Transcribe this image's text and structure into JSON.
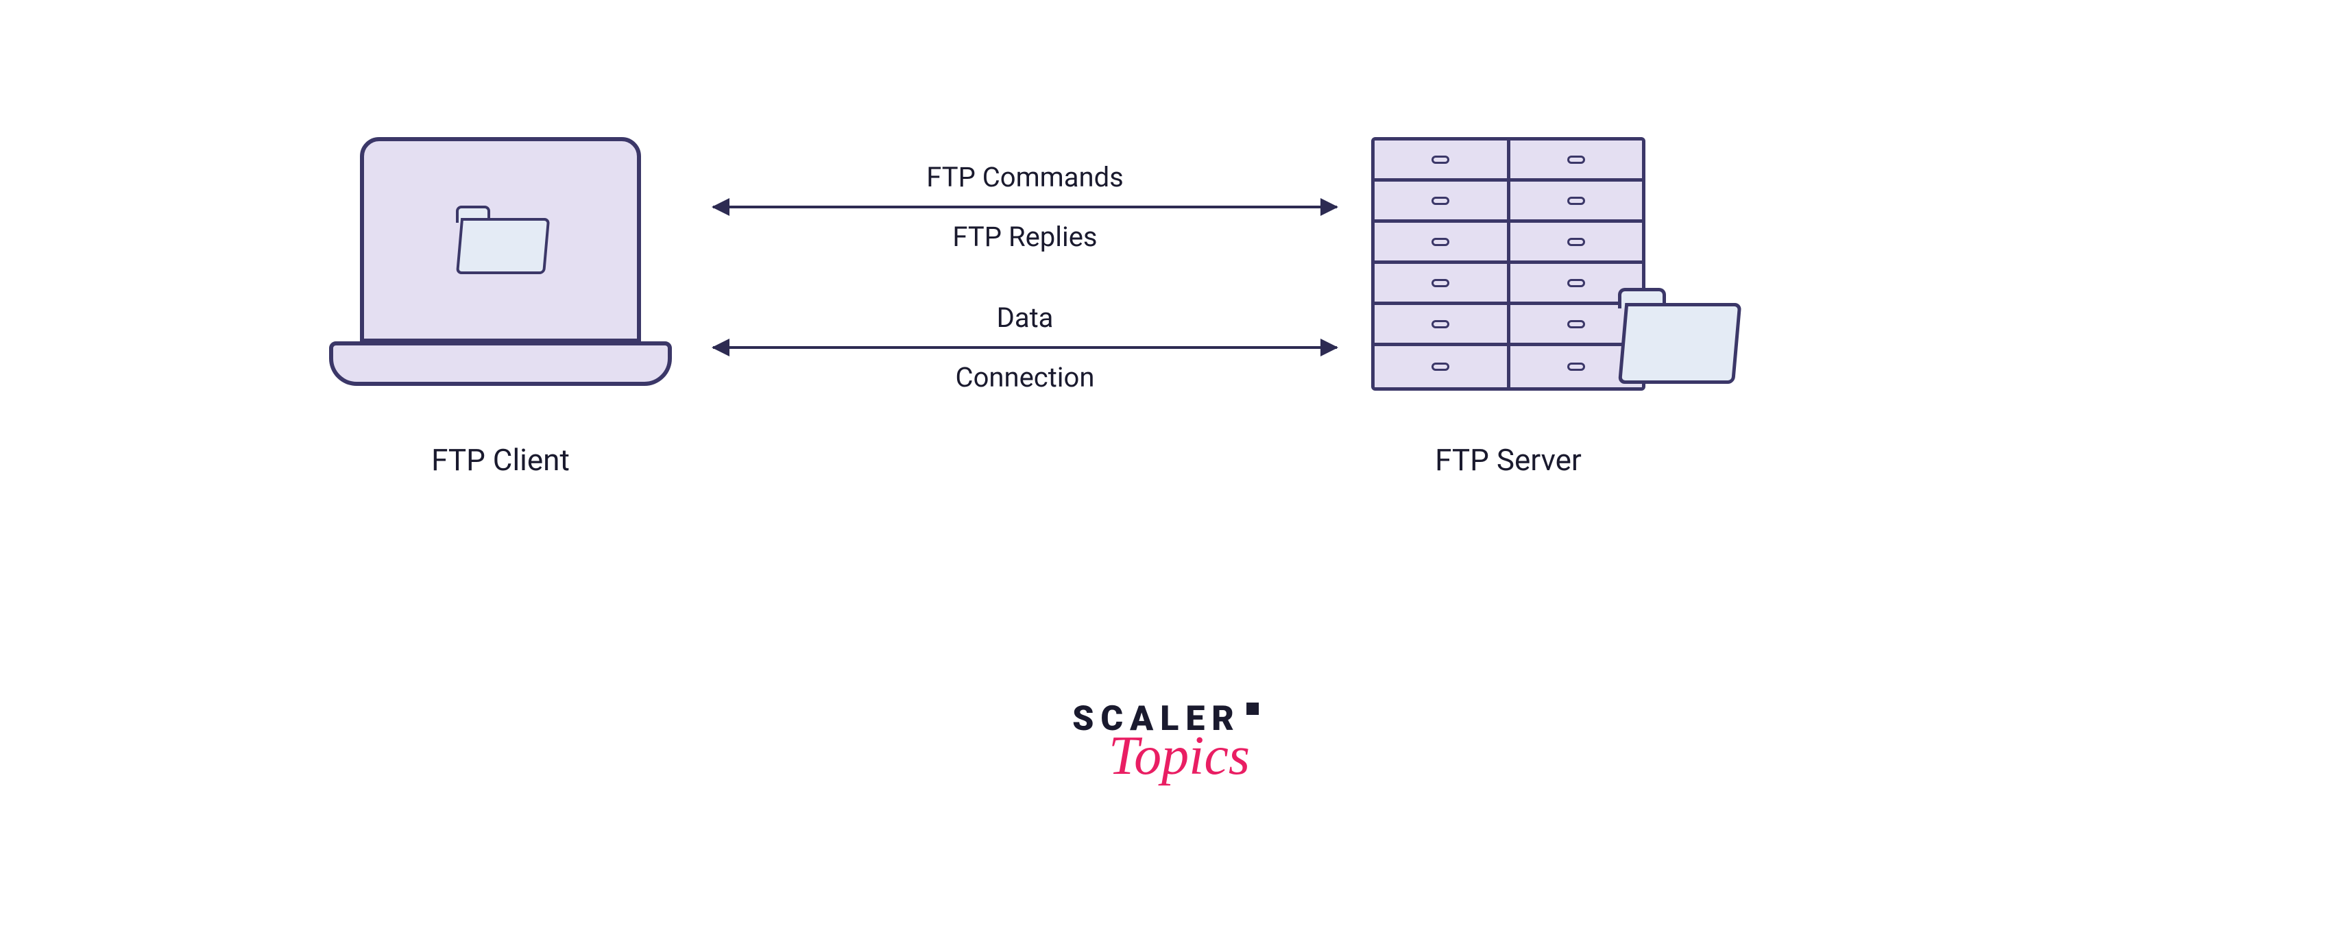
{
  "diagram": {
    "client_label": "FTP Client",
    "server_label": "FTP Server",
    "arrows": {
      "control": {
        "top": "FTP Commands",
        "bottom": "FTP Replies"
      },
      "data": {
        "top": "Data",
        "bottom": "Connection"
      }
    }
  },
  "logo": {
    "main": "SCALER",
    "sub": "Topics"
  },
  "colors": {
    "stroke": "#3B3768",
    "fill_purple": "#E4DFF2",
    "fill_blue": "#E4EBF5",
    "text": "#1a1a2e",
    "accent": "#E91E63"
  }
}
